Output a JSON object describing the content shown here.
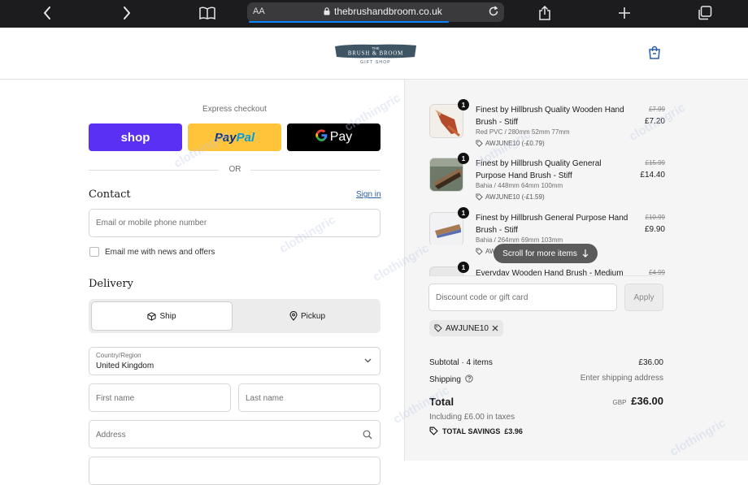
{
  "browser": {
    "aa_label": "AA",
    "url": "thebrushandbroom.co.uk"
  },
  "brand": {
    "logo_top": "THE",
    "logo_main": "BRUSH & BROOM",
    "logo_sub": "GIFT SHOP"
  },
  "express": {
    "label": "Express checkout",
    "shop_label": "shop",
    "paypal_part1": "Pay",
    "paypal_part2": "Pal",
    "gpay_label": "Pay",
    "or_label": "OR"
  },
  "contact": {
    "heading": "Contact",
    "signin_label": "Sign in",
    "email_placeholder": "Email or mobile phone number",
    "newsletter_label": "Email me with news and offers"
  },
  "delivery": {
    "heading": "Delivery",
    "ship_label": "Ship",
    "pickup_label": "Pickup",
    "country_label": "Country/Region",
    "country_value": "United Kingdom",
    "first_name_placeholder": "First name",
    "last_name_placeholder": "Last name",
    "address_placeholder": "Address"
  },
  "cart": {
    "items": [
      {
        "name": "Finest by Hillbrush Quality Wooden Hand Brush - Stiff",
        "variant": "Red PVC / 280mm 52mm 77mm",
        "discount": "AWJUNE10 (-£0.79)",
        "original_price": "£7.99",
        "price": "£7.20",
        "quantity": "1"
      },
      {
        "name": "Finest by Hillbrush Quality General Purpose Hand Brush - Stiff",
        "variant": "Bahia / 448mm 64mm 100mm",
        "discount": "AWJUNE10 (-£1.59)",
        "original_price": "£15.99",
        "price": "£14.40",
        "quantity": "1"
      },
      {
        "name": "Finest by Hillbrush General Purpose Hand Brush - Stiff",
        "variant": "Bahia / 264mm 69mm 103mm",
        "discount": "AW",
        "original_price": "£10.99",
        "price": "£9.90",
        "quantity": "1"
      },
      {
        "name": "Everyday Wooden Hand Brush - Medium",
        "original_price": "£4.99",
        "quantity": "1"
      }
    ],
    "scroll_hint": "Scroll for more items",
    "discount_placeholder": "Discount code or gift card",
    "apply_label": "Apply",
    "applied_code": "AWJUNE10"
  },
  "summary": {
    "subtotal_label": "Subtotal · 4 items",
    "subtotal_value": "£36.00",
    "shipping_label": "Shipping",
    "shipping_value": "Enter shipping address",
    "total_label": "Total",
    "currency": "GBP",
    "total_value": "£36.00",
    "tax_note": "Including £6.00 in taxes",
    "savings_label": "TOTAL SAVINGS",
    "savings_value": "£3.96"
  },
  "watermark": "clothingric",
  "colors": {
    "shop": "#5a31f4",
    "paypal": "#ffc439",
    "link": "#2a5ea8",
    "logo": "#3e5566"
  }
}
